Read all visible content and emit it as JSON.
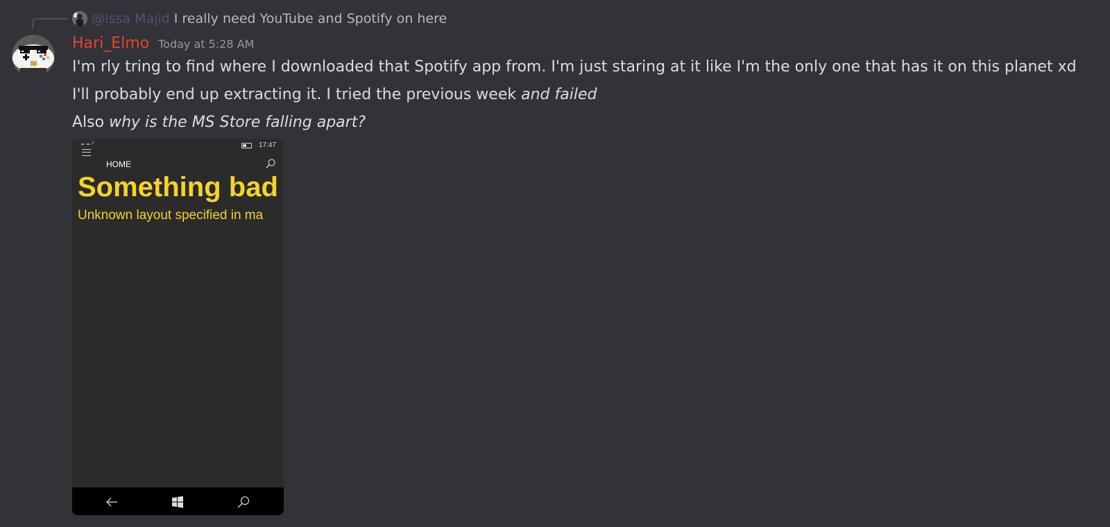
{
  "reply": {
    "mention": "@Issa Majid",
    "text": "I really need YouTube and Spotify on here"
  },
  "message": {
    "username": "Hari_Elmo",
    "username_color": "#e2462b",
    "timestamp": "Today at 5:28 AM",
    "line1": "I'm rly tring to find where I downloaded that Spotify app from. I'm just staring at it like I'm the only one that has it on this planet xd",
    "line2_plain": "I'll probably end up extracting it. I tried the previous week ",
    "line2_italic": "and failed",
    "line3_plain": "Also ",
    "line3_italic": "why is the MS Store falling apart?"
  },
  "attachment": {
    "status_time": "17:47",
    "page_title": "HOME",
    "error_title": "Something bad",
    "error_subtitle": "Unknown layout specified in ma",
    "accent_color": "#f4d32b"
  },
  "icons": [
    "reply-avatar",
    "user-avatar",
    "battery-icon",
    "signal-icon",
    "hamburger-icon",
    "search-icon",
    "back-icon",
    "windows-icon"
  ]
}
